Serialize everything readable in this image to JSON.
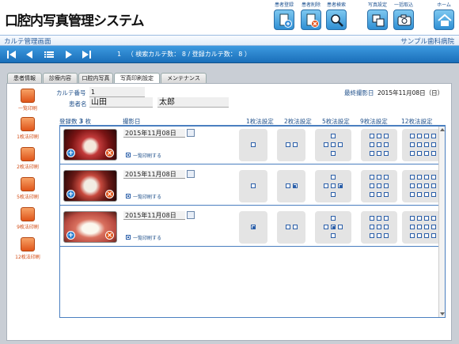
{
  "app": {
    "title": "口腔内写真管理システム",
    "screen": "カルテ管理画面",
    "clinic": "サンプル歯科病院"
  },
  "toolbar": {
    "register": "患者登録",
    "delete": "患者削除",
    "search": "患者検索",
    "photo_settings": "写真設定",
    "batch_import": "一括取込",
    "home": "ホーム"
  },
  "nav": {
    "record_index": "1",
    "search_count_label": "（ 検索カルテ数：",
    "search_count": "8",
    "reg_count_label": "/ 登録カルテ数：",
    "reg_count": "8",
    "close": "）"
  },
  "tabs": [
    "患者情報",
    "診療内容",
    "口腔内写真",
    "写真印刷設定",
    "メンテナンス"
  ],
  "active_tab": 3,
  "sidebar": [
    "一覧印刷",
    "1枚法印刷",
    "2枚法印刷",
    "5枚法印刷",
    "9枚法印刷",
    "12枚法印刷"
  ],
  "patient": {
    "record_label": "カルテ番号",
    "record_no": "1",
    "name_label": "患者名",
    "last_name": "山田",
    "first_name": "太郎",
    "last_date_label": "最終撮影日",
    "last_date": "2015年11月08日（日）"
  },
  "list": {
    "count_label": "登録数",
    "count": "3",
    "count_unit": "枚",
    "date_header": "撮影日",
    "method_headers": [
      "1枚法設定",
      "2枚法設定",
      "5枚法設定",
      "9枚法設定",
      "12枚法設定"
    ],
    "rows": [
      {
        "date": "2015年11月08日",
        "print_label": "一覧印刷する",
        "checked": true,
        "marks": {
          "m1": "",
          "m2": "",
          "m5": "",
          "m9": "",
          "m12": ""
        }
      },
      {
        "date": "2015年11月08日",
        "print_label": "一覧印刷する",
        "checked": true,
        "marks": {
          "m1": "",
          "m2": "2",
          "m5": "5-4",
          "m9": "",
          "m12": ""
        }
      },
      {
        "date": "2015年11月08日",
        "print_label": "一覧印刷する",
        "checked": true,
        "marks": {
          "m1": "1",
          "m2": "",
          "m5": "5-3",
          "m9": "",
          "m12": ""
        }
      }
    ]
  },
  "colors": {
    "accent": "#1a6fb9",
    "sidebar": "#e0551a",
    "grid": "#4a7fc0"
  },
  "icons": {
    "nav": [
      "first-icon",
      "prev-icon",
      "list-icon",
      "next-icon",
      "last-icon"
    ]
  }
}
